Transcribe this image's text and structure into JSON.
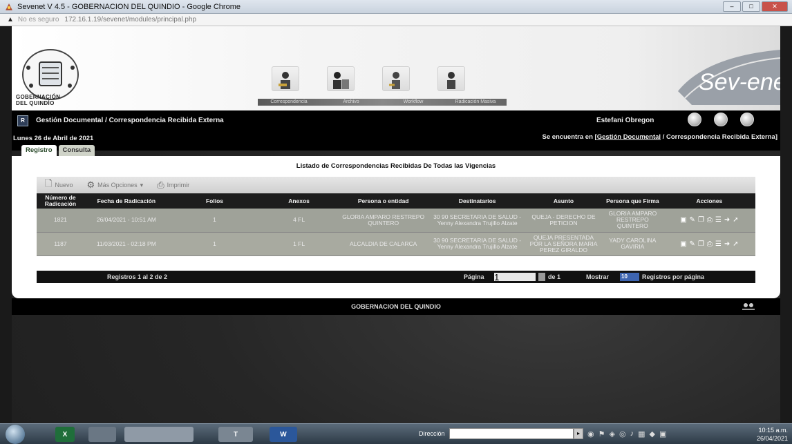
{
  "window": {
    "title": "Sevenet V 4.5 - GOBERNACION DEL QUINDIO - Google Chrome",
    "controls": {
      "minimize": "–",
      "maximize": "□",
      "close": "✕"
    }
  },
  "address_bar": {
    "warning_icon": "warning-icon",
    "security_label": "No es seguro",
    "url": "172.16.1.19/sevenet/modules/principal.php"
  },
  "header": {
    "logo_text_line1": "GOBERNACIÓN",
    "logo_text_line2": "DEL QUINDÍO",
    "nav_items": [
      {
        "label": "Correspondencia",
        "icon": "person-desk-icon"
      },
      {
        "label": "Archivo",
        "icon": "person-files-icon"
      },
      {
        "label": "Workflow",
        "icon": "person-flow-icon"
      },
      {
        "label": "Radicación Masiva",
        "icon": "person-stack-icon"
      }
    ],
    "brand_text": "Sev-enet"
  },
  "module_bar": {
    "module_icon_text": "R",
    "title": "Gestión Documental / Correspondencia Recibida Externa",
    "user": "Estefani Obregon",
    "date": "Lunes 26 de Abril de 2021",
    "location_prefix": "Se encuentra en [",
    "location_link": "Gestión Documental",
    "location_suffix": " / Correspondencia Recibida Externa]"
  },
  "tabs": [
    {
      "label": "Registro",
      "active": true
    },
    {
      "label": "Consulta",
      "active": false
    }
  ],
  "list": {
    "title": "Listado de Correspondencias Recibidas De Todas las Vigencias",
    "toolbar": [
      {
        "label": "Nuevo",
        "icon": "new-document-icon"
      },
      {
        "label": "Más Opciones",
        "icon": "options-icon"
      },
      {
        "label": "Imprimir",
        "icon": "print-icon"
      }
    ],
    "columns": [
      "Número de Radicación",
      "Fecha de Radicación",
      "Folios",
      "Anexos",
      "Persona o entidad",
      "Destinatarios",
      "Asunto",
      "Persona que Firma",
      "Acciones"
    ],
    "rows": [
      {
        "numero": "1821",
        "fecha": "26/04/2021 - 10:51 AM",
        "folios": "1",
        "anexos": "4 FL",
        "persona": "GLORIA AMPARO RESTREPO QUINTERO",
        "destinatarios": "30 90 SECRETARIA DE SALUD - Yenny Alexandra Trujillo Alzate",
        "asunto": "QUEJA - DERECHO DE PETICION",
        "firma": "GLORIA AMPARO RESTREPO QUINTERO"
      },
      {
        "numero": "1187",
        "fecha": "11/03/2021 - 02:18 PM",
        "folios": "1",
        "anexos": "1 FL",
        "persona": "ALCALDIA DE CALARCA",
        "destinatarios": "30 90 SECRETARIA DE SALUD - Yenny Alexandra Trujillo Alzate",
        "asunto": "QUEJA PRESENTADA POR LA SEÑORA MARIA PEREZ GIRALDO",
        "firma": "YADY CAROLINA GAVIRIA"
      }
    ],
    "action_icons": [
      "edit-icon",
      "pencil-icon",
      "copy-icon",
      "print-icon",
      "list-icon",
      "forward-icon",
      "arrow-icon"
    ]
  },
  "pager": {
    "records": "Registros 1 al 2 de 2",
    "page_label": "Página",
    "page_value": "1",
    "of_label": "de 1",
    "show_label": "Mostrar",
    "show_value": "10",
    "per_page_label": "Registros por página"
  },
  "footer": {
    "text": "GOBERNACION DEL QUINDIO",
    "logo_icon": "sevenet-small-logo-icon"
  },
  "taskbar": {
    "apps": [
      {
        "label": "X",
        "name": "excel-taskbar-app"
      },
      {
        "label": "",
        "name": "scanner-taskbar-app"
      },
      {
        "label": "",
        "name": "chrome-taskbar-app"
      },
      {
        "label": "T",
        "name": "teams-taskbar-app"
      },
      {
        "label": "W",
        "name": "word-taskbar-app"
      }
    ],
    "address_label": "Dirección",
    "time": "10:15 a.m.",
    "date": "26/04/2021"
  }
}
